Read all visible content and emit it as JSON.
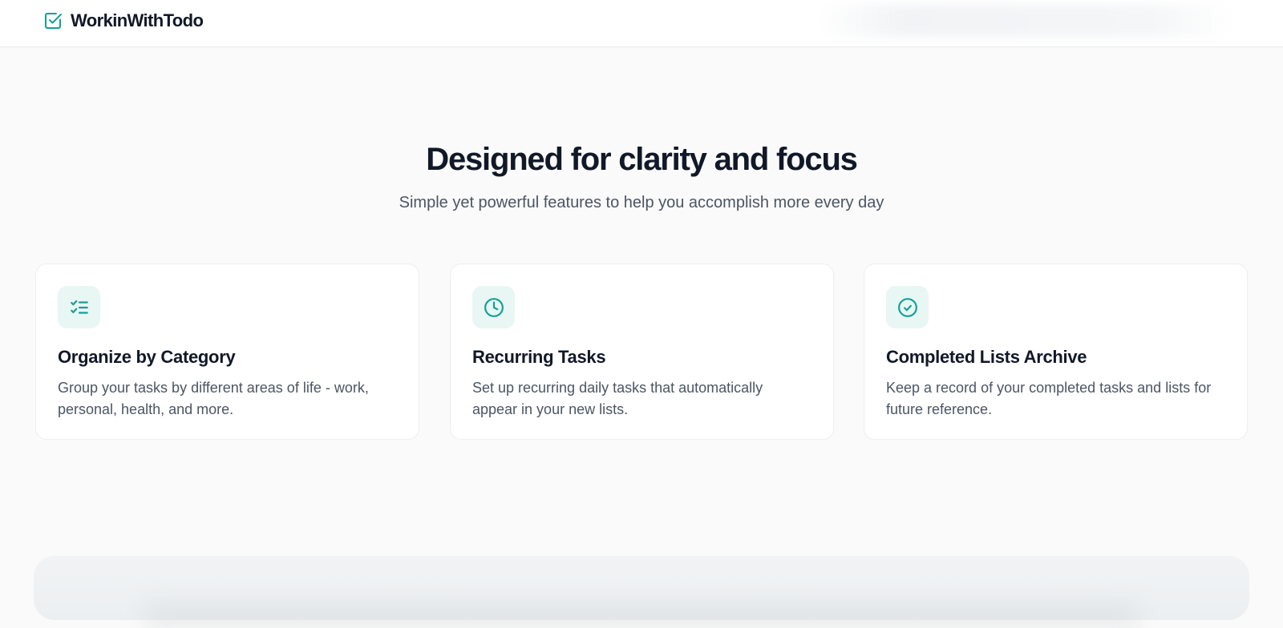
{
  "header": {
    "brand_name": "WorkinWithTodo",
    "brand_icon": "checkbox-check-icon",
    "accent_color": "#14a093"
  },
  "hero": {
    "title": "Designed for clarity and focus",
    "subtitle": "Simple yet powerful features to help you accomplish more every day"
  },
  "features": [
    {
      "icon": "list-checks-icon",
      "title": "Organize by Category",
      "description": "Group your tasks by different areas of life - work, personal, health, and more."
    },
    {
      "icon": "clock-icon",
      "title": "Recurring Tasks",
      "description": "Set up recurring daily tasks that automatically appear in your new lists."
    },
    {
      "icon": "check-circle-icon",
      "title": "Completed Lists Archive",
      "description": "Keep a record of your completed tasks and lists for future reference."
    }
  ]
}
